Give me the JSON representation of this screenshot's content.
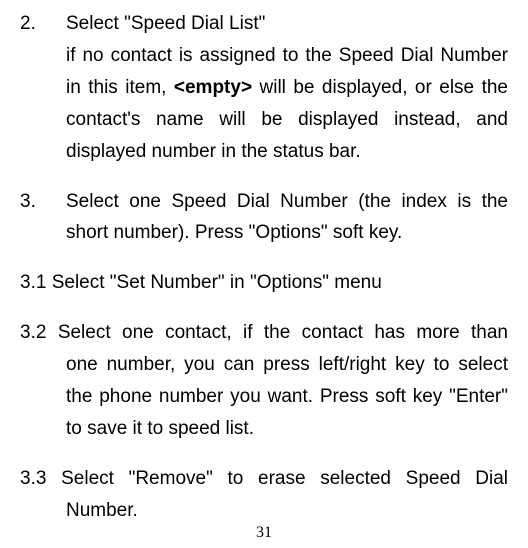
{
  "items": [
    {
      "num": "2.",
      "first": "Select \"Speed Dial List\"",
      "body_before": "if no contact is assigned to the Speed Dial Number in this item, ",
      "body_bold": "<empty>",
      "body_after": " will be displayed, or else the contact's name will be displayed instead, and displayed number in the status bar."
    },
    {
      "num": "3.",
      "first": "Select one Speed Dial Number (the index is the",
      "body_before": "short number). Press \"Options\" soft key.",
      "body_bold": "",
      "body_after": ""
    }
  ],
  "subs": [
    {
      "label": "3.1",
      "first": "Select \"Set Number\" in \"Options\" menu",
      "body": ""
    },
    {
      "label": "3.2",
      "first": "Select one contact, if the contact has more than",
      "body": "one number, you can press left/right key to select the phone number you want. Press soft key \"Enter\" to save it to speed list."
    },
    {
      "label": "3.3",
      "first": "Select \"Remove\" to erase selected Speed Dial",
      "body": "Number."
    }
  ],
  "page_number": "31"
}
